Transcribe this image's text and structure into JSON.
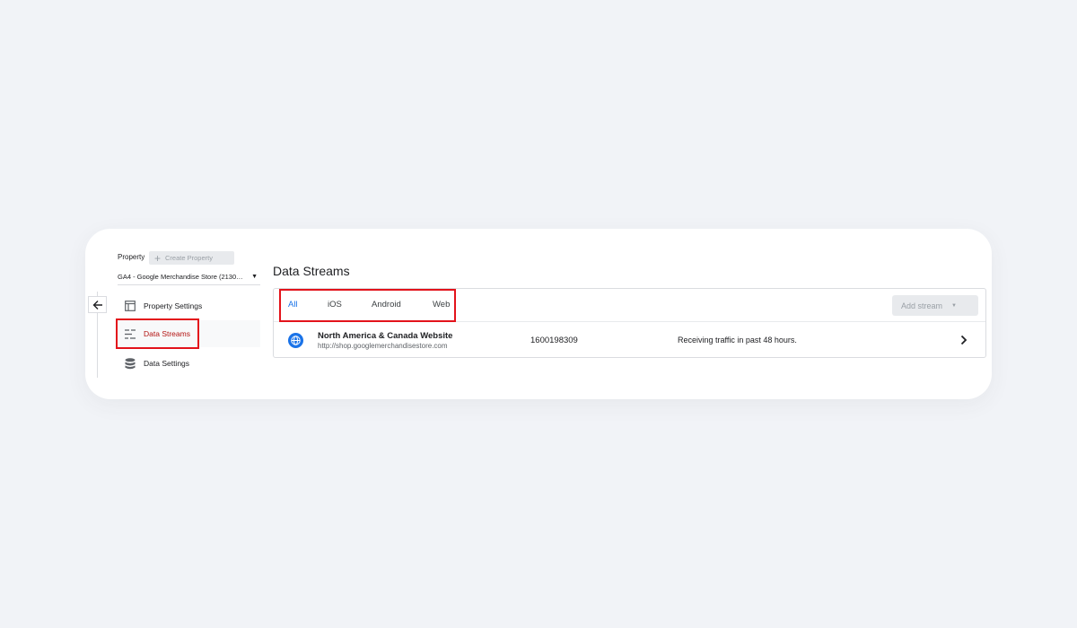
{
  "property": {
    "label": "Property",
    "create_button": "Create Property",
    "selected": "GA4 - Google Merchandise Store (2130…"
  },
  "nav": {
    "items": [
      {
        "label": "Property Settings",
        "icon": "layout-icon"
      },
      {
        "label": "Data Streams",
        "icon": "streams-icon"
      },
      {
        "label": "Data Settings",
        "icon": "database-icon"
      }
    ],
    "active": "Data Streams"
  },
  "main": {
    "title": "Data Streams",
    "tabs": [
      {
        "label": "All"
      },
      {
        "label": "iOS"
      },
      {
        "label": "Android"
      },
      {
        "label": "Web"
      }
    ],
    "add_stream": "Add stream",
    "streams": [
      {
        "name": "North America & Canada Website",
        "url": "http://shop.googlemerchandisestore.com",
        "id": "1600198309",
        "status": "Receiving traffic in past 48 hours."
      }
    ]
  },
  "colors": {
    "accent": "#1a73e8",
    "active_nav": "#b31412",
    "highlight": "#e3131b",
    "background": "#f1f3f7"
  }
}
